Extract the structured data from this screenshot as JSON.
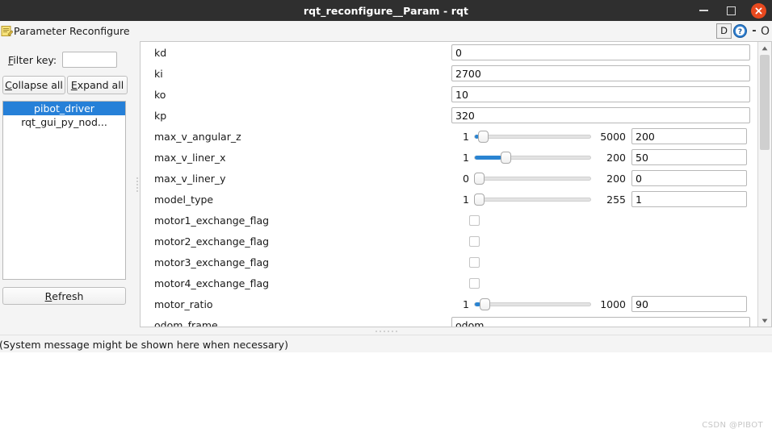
{
  "window": {
    "title": "rqt_reconfigure__Param - rqt",
    "minimize_icon": "minimize-icon",
    "maximize_icon": "maximize-icon",
    "close_icon": "close-icon"
  },
  "plugin_header": {
    "icon": "parameter-reconfigure-icon",
    "title": "Parameter Reconfigure",
    "dock_button_label": "D",
    "help_icon": "help-question-icon",
    "minimize_label": "-",
    "close_label": "O"
  },
  "sidebar": {
    "filter_label_prefix": "F",
    "filter_label": "Filter key:",
    "filter_value": "",
    "filter_placeholder": "",
    "collapse_button": "Collapse all",
    "expand_button": "Expand all",
    "refresh_button": "Refresh",
    "nodes": [
      {
        "label": "pibot_driver",
        "selected": true
      },
      {
        "label": "rqt_gui_py_nod...",
        "selected": false
      }
    ]
  },
  "params": [
    {
      "name": "kd",
      "type": "text",
      "value": "0"
    },
    {
      "name": "ki",
      "type": "text",
      "value": "2700"
    },
    {
      "name": "ko",
      "type": "text",
      "value": "10"
    },
    {
      "name": "kp",
      "type": "text",
      "value": "320"
    },
    {
      "name": "max_v_angular_z",
      "type": "slider",
      "min": "1",
      "max": "5000",
      "value": "200",
      "percent": 4
    },
    {
      "name": "max_v_liner_x",
      "type": "slider",
      "min": "1",
      "max": "200",
      "value": "50",
      "percent": 25
    },
    {
      "name": "max_v_liner_y",
      "type": "slider",
      "min": "0",
      "max": "200",
      "value": "0",
      "percent": 0
    },
    {
      "name": "model_type",
      "type": "slider",
      "min": "1",
      "max": "255",
      "value": "1",
      "percent": 0
    },
    {
      "name": "motor1_exchange_flag",
      "type": "checkbox",
      "checked": false
    },
    {
      "name": "motor2_exchange_flag",
      "type": "checkbox",
      "checked": false
    },
    {
      "name": "motor3_exchange_flag",
      "type": "checkbox",
      "checked": false
    },
    {
      "name": "motor4_exchange_flag",
      "type": "checkbox",
      "checked": false
    },
    {
      "name": "motor_ratio",
      "type": "slider",
      "min": "1",
      "max": "1000",
      "value": "90",
      "percent": 5
    },
    {
      "name": "odom_frame",
      "type": "text",
      "value": "odom"
    }
  ],
  "statusbar": {
    "message": "(System message might be shown here when necessary)"
  },
  "watermark": {
    "text": "CSDN @PIBOT"
  },
  "colors": {
    "titlebar_bg": "#2f2f2f",
    "close_button": "#e8491f",
    "selection_blue": "#2680d8",
    "slider_fill": "#2a84d2",
    "panel_bg": "#f4f4f4"
  }
}
